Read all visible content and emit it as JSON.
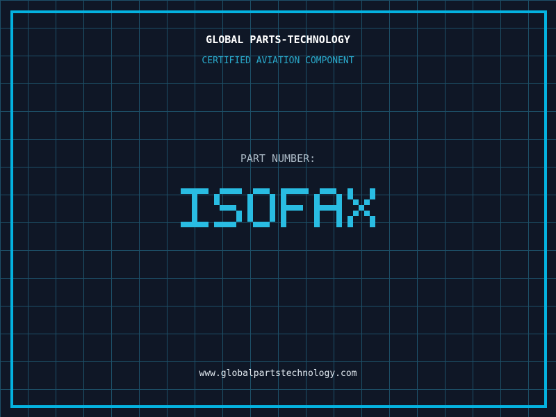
{
  "page": {
    "background_color": "#0f1726",
    "grid_color": "#1d5068",
    "frame_color": "#04b2e0"
  },
  "header": {
    "company_name": "GLOBAL PARTS-TECHNOLOGY",
    "company_name_color": "#ffffff",
    "tagline": "CERTIFIED AVIATION COMPONENT",
    "tagline_color": "#2aabcd"
  },
  "part": {
    "label": "PART NUMBER:",
    "label_color": "#aab8c4",
    "number": "ISOFAX",
    "number_color": "#29bce2"
  },
  "footer": {
    "website": "www.globalpartstechnology.com",
    "website_color": "#e1e9f0"
  }
}
